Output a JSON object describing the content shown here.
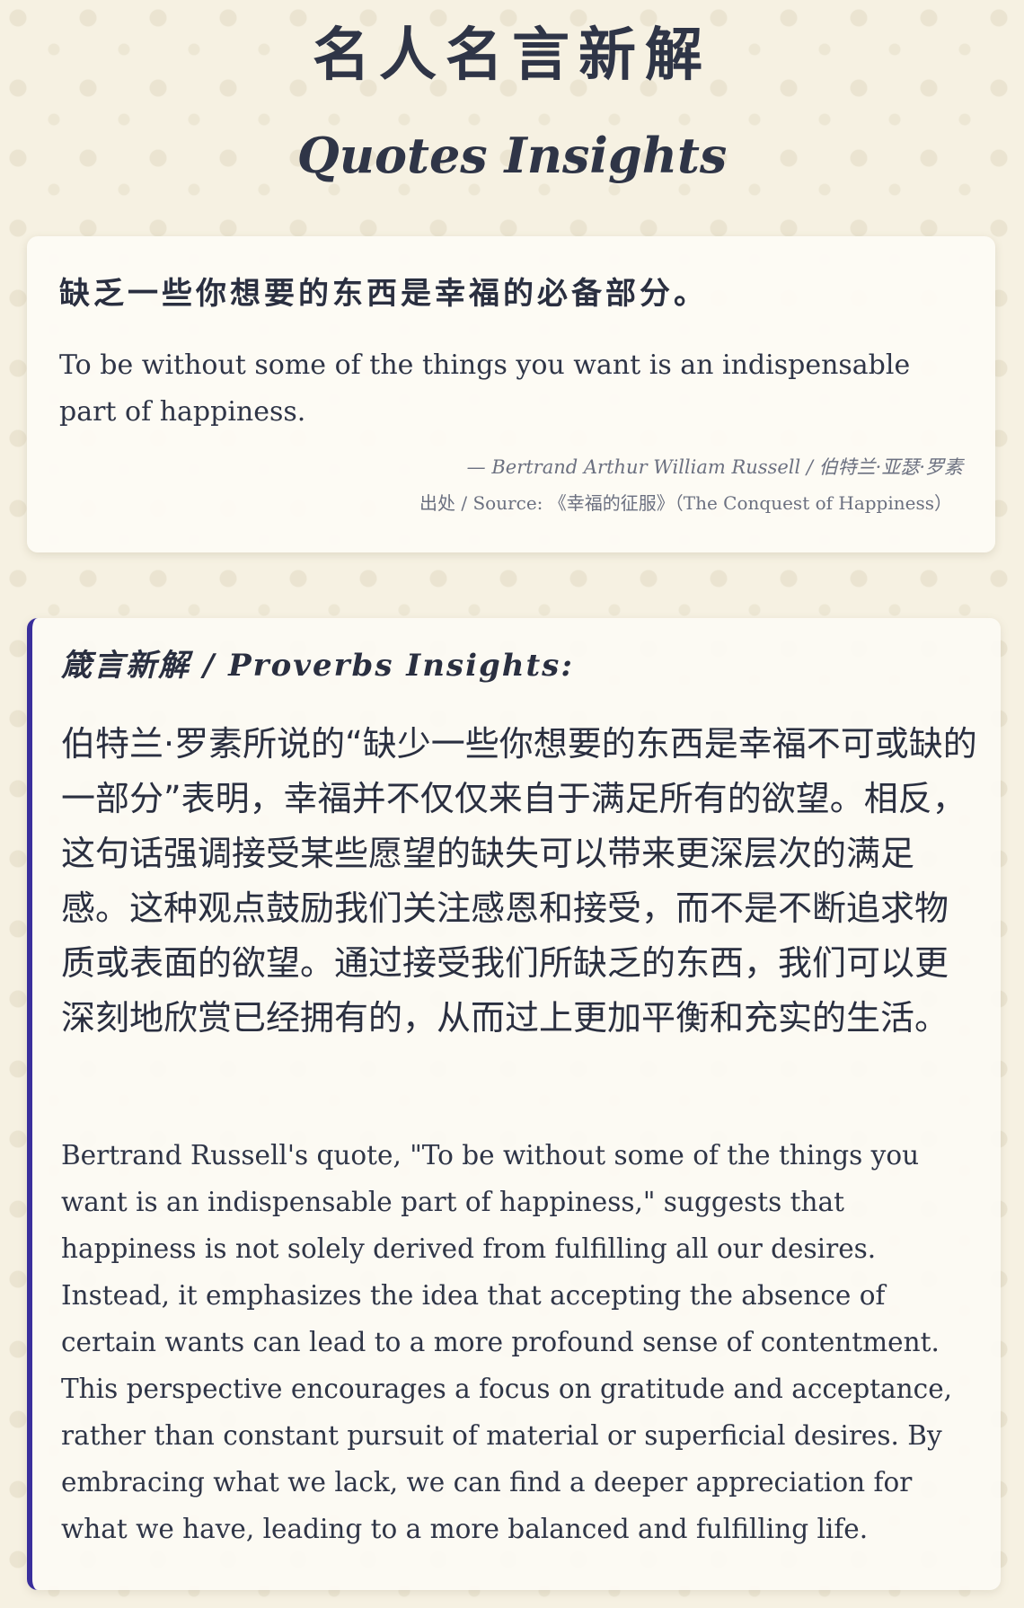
{
  "header": {
    "title_zh": "名人名言新解",
    "title_en": "Quotes Insights"
  },
  "quote": {
    "text_zh": "缺乏一些你想要的东西是幸福的必备部分。",
    "text_en": "To be without some of the things you want is an indispensable part of happiness.",
    "author": "— Bertrand Arthur William Russell / 伯特兰·亚瑟·罗素",
    "source": "出处 / Source: 《幸福的征服》（The Conquest of Happiness）"
  },
  "insight": {
    "heading": "箴言新解 / Proverbs Insights:",
    "text_zh": "伯特兰·罗素所说的“缺少一些你想要的东西是幸福不可或缺的一部分”表明，幸福并不仅仅来自于满足所有的欲望。相反，这句话强调接受某些愿望的缺失可以带来更深层次的满足感。这种观点鼓励我们关注感恩和接受，而不是不断追求物质或表面的欲望。通过接受我们所缺乏的东西，我们可以更深刻地欣赏已经拥有的，从而过上更加平衡和充实的生活。",
    "text_en": "Bertrand Russell's quote, \"To be without some of the things you want is an indispensable part of happiness,\" suggests that happiness is not solely derived from fulfilling all our desires. Instead, it emphasizes the idea that accepting the absence of certain wants can lead to a more profound sense of contentment. This perspective encourages a focus on gratitude and acceptance, rather than constant pursuit of material or superficial desires. By embracing what we lack, we can find a deeper appreciation for what we have, leading to a more balanced and fulfilling life."
  },
  "colors": {
    "background": "#f6f1e2",
    "card": "#fdfbf5",
    "accent_border": "#3a2f9c",
    "text": "#2f3547",
    "muted": "#6b7080"
  }
}
